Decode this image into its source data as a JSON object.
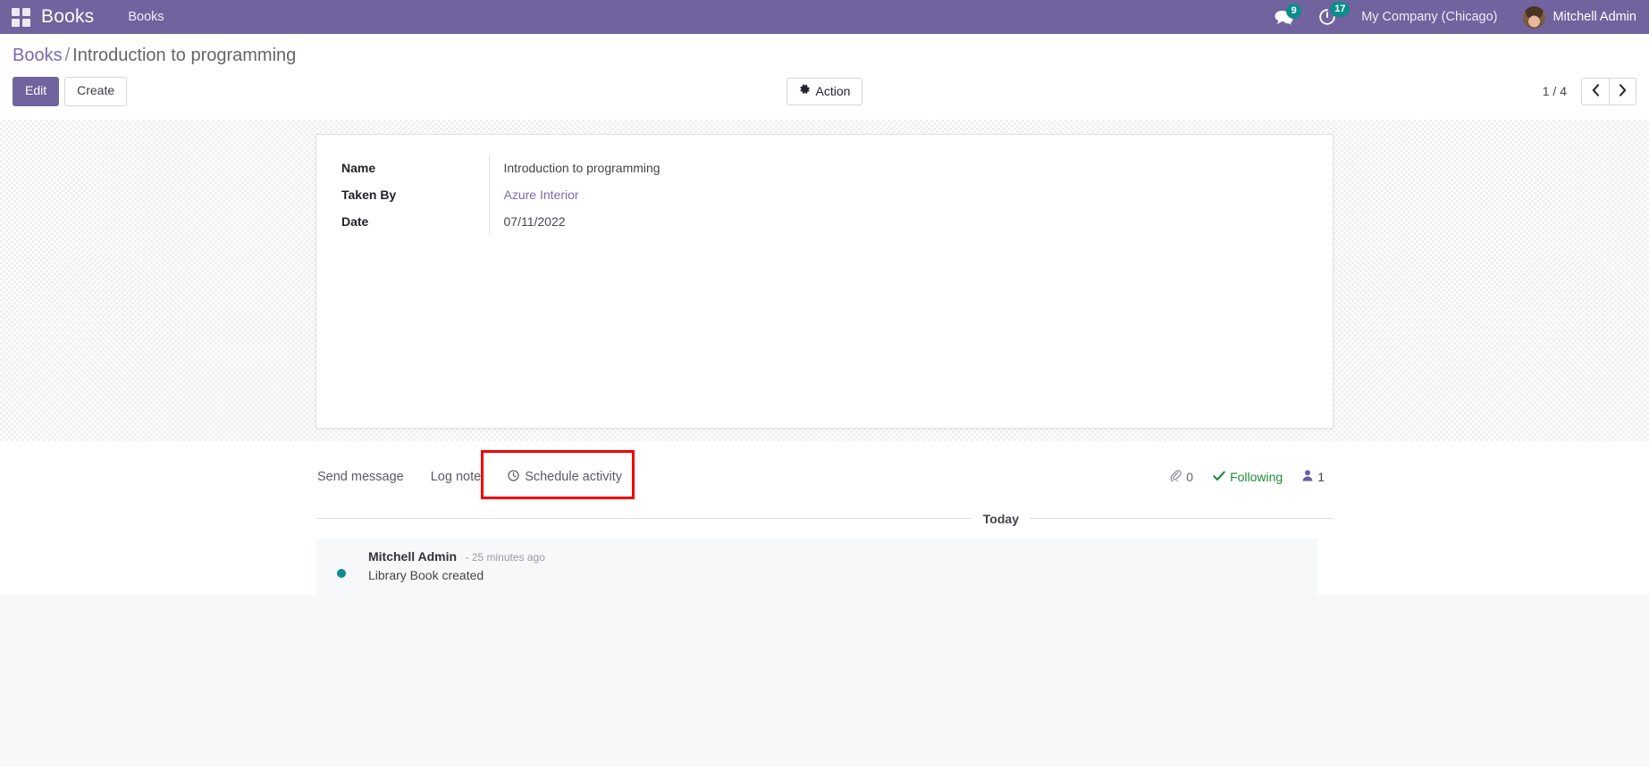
{
  "navbar": {
    "apps_icon": "apps-grid-icon",
    "brand": "Books",
    "menu_items": [
      {
        "label": "Books"
      }
    ],
    "messaging_icon": "chat-bubble-icon",
    "messaging_count": "9",
    "activities_icon": "clock-icon",
    "activities_count": "17",
    "company": "My Company (Chicago)",
    "user": "Mitchell Admin"
  },
  "control_panel": {
    "breadcrumb": {
      "parent": "Books",
      "separator": "/",
      "current": "Introduction to programming"
    },
    "edit_label": "Edit",
    "create_label": "Create",
    "action_label": "Action",
    "action_icon": "gear-icon",
    "pager": {
      "counter": "1 / 4",
      "prev_icon": "chevron-left-icon",
      "next_icon": "chevron-right-icon"
    }
  },
  "form": {
    "fields": [
      {
        "label": "Name",
        "value": "Introduction to programming",
        "type": "text"
      },
      {
        "label": "Taken By",
        "value": "Azure Interior",
        "type": "link"
      },
      {
        "label": "Date",
        "value": "07/11/2022",
        "type": "text"
      }
    ]
  },
  "chatter": {
    "send_message_label": "Send message",
    "log_note_label": "Log note",
    "schedule_activity_label": "Schedule activity",
    "schedule_activity_icon": "clock-icon",
    "highlight_color": "#f40000",
    "attachment_icon": "paperclip-icon",
    "attachment_count": "0",
    "following_icon": "check-icon",
    "following_label": "Following",
    "followers_icon": "user-icon",
    "followers_count": "1",
    "date_separator": "Today",
    "messages": [
      {
        "author": "Mitchell Admin",
        "time": "- 25 minutes ago",
        "body": "Library Book created",
        "avatar": "avatar-mitchell-admin"
      }
    ]
  },
  "colors": {
    "brand_purple": "#71639e",
    "link_purple": "#7c69ad",
    "badge_teal": "#0d8c8c",
    "following_green": "#1c8c35",
    "highlight_red": "#f40000"
  }
}
